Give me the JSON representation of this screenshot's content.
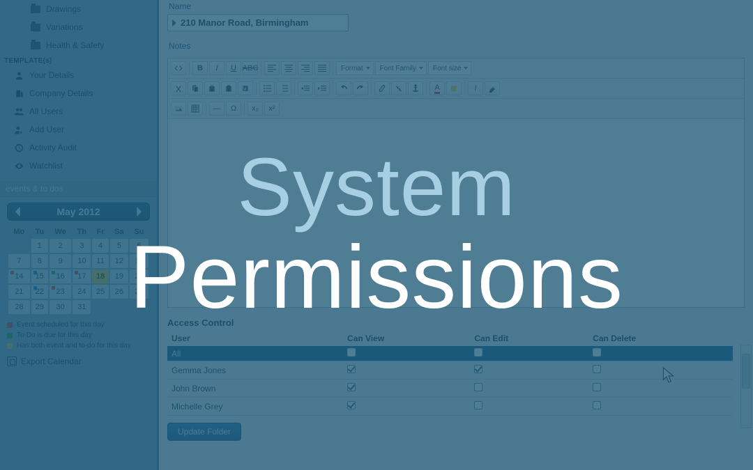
{
  "overlay": {
    "line1": "System",
    "line2": "Permissions"
  },
  "sidebar": {
    "folders": [
      {
        "label": "Drawings"
      },
      {
        "label": "Variations"
      },
      {
        "label": "Health & Safety"
      }
    ],
    "section_label": "TEMPLATE(s)",
    "items": [
      {
        "label": "Your Details"
      },
      {
        "label": "Company Details"
      },
      {
        "label": "All Users"
      },
      {
        "label": "Add User"
      },
      {
        "label": "Activity Audit"
      },
      {
        "label": "Watchlist"
      }
    ],
    "events_header": "events & to dos",
    "calendar": {
      "title": "May 2012",
      "days": [
        "Mo",
        "Tu",
        "We",
        "Th",
        "Fr",
        "Sa",
        "Su"
      ],
      "weeks": [
        [
          "",
          "1",
          "2",
          "3",
          "4",
          "5",
          "6"
        ],
        [
          "7",
          "8",
          "9",
          "10",
          "11",
          "12",
          "13"
        ],
        [
          "14",
          "15",
          "16",
          "17",
          "18",
          "19",
          "20"
        ],
        [
          "21",
          "22",
          "23",
          "24",
          "25",
          "26",
          "27"
        ],
        [
          "28",
          "29",
          "30",
          "31",
          "",
          "",
          ""
        ]
      ],
      "today": "18"
    },
    "legend": [
      "Event scheduled for this day",
      "To-Do is due for this day",
      "Has both event and to-do for this day"
    ],
    "export_label": "Export Calendar"
  },
  "form": {
    "name_label": "Name",
    "name_value": "210 Manor Road, Birmingham",
    "notes_label": "Notes",
    "toolbar_selects": {
      "format": "Format",
      "font_family": "Font Family",
      "font_size": "Font size"
    }
  },
  "access": {
    "title": "Access Control",
    "columns": [
      "User",
      "Can View",
      "Can Edit",
      "Can Delete"
    ],
    "all_label": "All",
    "rows": [
      {
        "user": "Gemma Jones",
        "view": true,
        "edit": true,
        "del": false
      },
      {
        "user": "John Brown",
        "view": true,
        "edit": false,
        "del": false
      },
      {
        "user": "Michelle Grey",
        "view": true,
        "edit": false,
        "del": false
      }
    ],
    "update_label": "Update Folder"
  }
}
